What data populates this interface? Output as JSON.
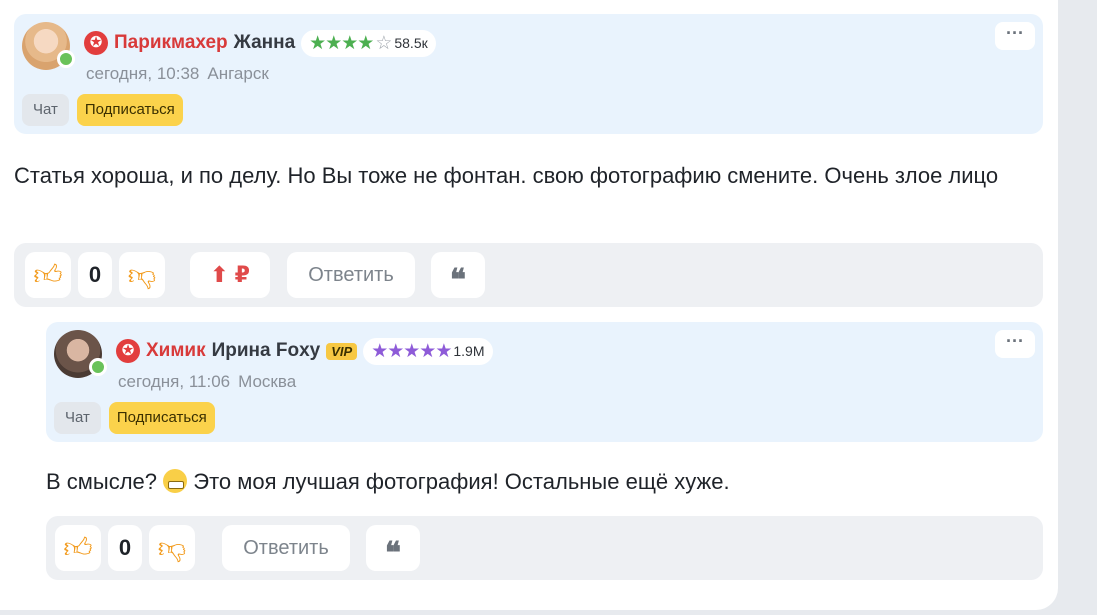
{
  "comments": [
    {
      "profession": "Парикмахер",
      "username": "Жанна",
      "rating_value": "58.5к",
      "stars_filled": "★★★★",
      "star_empty": "☆",
      "time": "сегодня, 10:38",
      "city": "Ангарск",
      "chat_label": "Чат",
      "subscribe_label": "Подписаться",
      "more_label": "···",
      "text": "Статья хороша, и по делу. Но Вы тоже не фонтан. свою фотографию смените. Очень злое лицо",
      "likes": "0",
      "donate_label": "⬆ ₽",
      "reply_label": "Ответить",
      "quote_label": "❝"
    },
    {
      "profession": "Химик",
      "username": "Ирина Foxy",
      "vip_label": "VIP",
      "rating_value": "1.9M",
      "stars_filled": "★★★★★",
      "time": "сегодня, 11:06",
      "city": "Москва",
      "chat_label": "Чат",
      "subscribe_label": "Подписаться",
      "more_label": "···",
      "text_before": "В смысле?",
      "text_after": "Это моя лучшая фотография! Остальные ещё хуже.",
      "likes": "0",
      "reply_label": "Ответить",
      "quote_label": "❝"
    }
  ],
  "colors": {
    "header_bg": "#e9f3fd",
    "profession": "#d83a3a",
    "stars_green": "#4caf50",
    "stars_purple": "#8e5bd8",
    "subscribe_bg": "#fbd24b",
    "thumb": "#f29a1b"
  },
  "icons": {
    "badge": "star-badge-icon",
    "like": "thumb-up-icon",
    "dislike": "thumb-down-icon",
    "donate": "ruble-up-icon",
    "quote": "quote-icon",
    "emoji": "grinning-emoji-icon"
  }
}
